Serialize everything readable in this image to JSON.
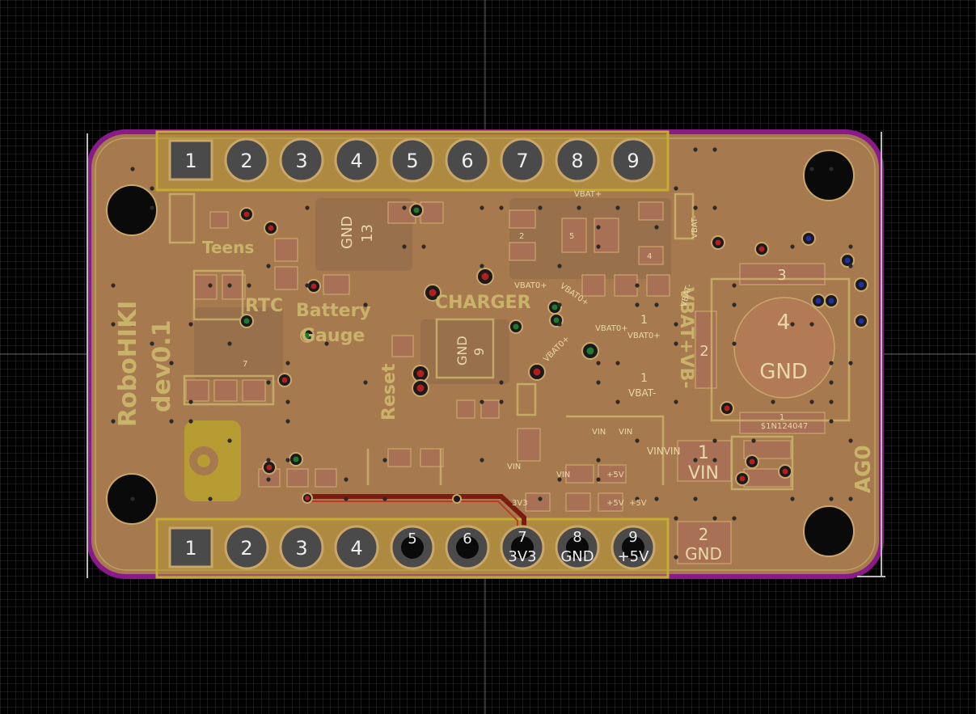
{
  "colors": {
    "background": "#000000",
    "grid": "#3c3c3c",
    "board_fill": "#a6794f",
    "board_outline": "#8a1a8a",
    "header_outline": "#b8a030",
    "pad_ring": "#c9a76a",
    "pad_hole": "#3a3a3a",
    "mount_hole": "#0a0a0a",
    "silk": "#c9b36a",
    "silk_text": "#e8d9a8",
    "via_red": "#b02020",
    "trace": "#7a1c10",
    "copper_pad": "#b07050"
  },
  "top_header": {
    "pins": [
      "1",
      "2",
      "3",
      "4",
      "5",
      "6",
      "7",
      "8",
      "9"
    ]
  },
  "bottom_header": {
    "pins": [
      "1",
      "2",
      "3",
      "4",
      "5",
      "6",
      "7",
      "8",
      "9"
    ],
    "pin_labels": [
      "",
      "",
      "",
      "",
      "",
      "",
      "3V3",
      "GND",
      "+5V"
    ]
  },
  "silk_labels": {
    "teens": "Teens",
    "rtc": "RTC",
    "battery": "Battery",
    "gauge": "Gauge",
    "charger": "CHARGER",
    "reset": "Reset",
    "robohiki": "RoboHIKI",
    "version": "dev0.1",
    "ag0": "AG0",
    "gnd_13": "GND",
    "pin_13": "13",
    "gnd_9": "GND",
    "pin_9": "9",
    "vbat_big": "VBAT+VB-",
    "vin_label": "VIN",
    "vin_pin": "1",
    "gnd_label": "GND",
    "gnd_pin": "2",
    "battery_pin": "4",
    "battery_gnd": "GND",
    "pad_3": "3",
    "pad_2_right": "2",
    "part_number": "$1N124047",
    "part_pin": "1"
  },
  "net_labels": [
    "VBAT+",
    "VBAT0+",
    "VBAT0+",
    "VBAT0+",
    "VBAT0+",
    "VBAT0+",
    "VBAT-",
    "VBAT-",
    "VBAT-",
    "VIN",
    "VIN",
    "VIN",
    "VIN",
    "VINVIN",
    "+5V",
    "+5V",
    "+5V",
    "3V3",
    "2",
    "5",
    "4",
    "1",
    "1",
    "7"
  ]
}
